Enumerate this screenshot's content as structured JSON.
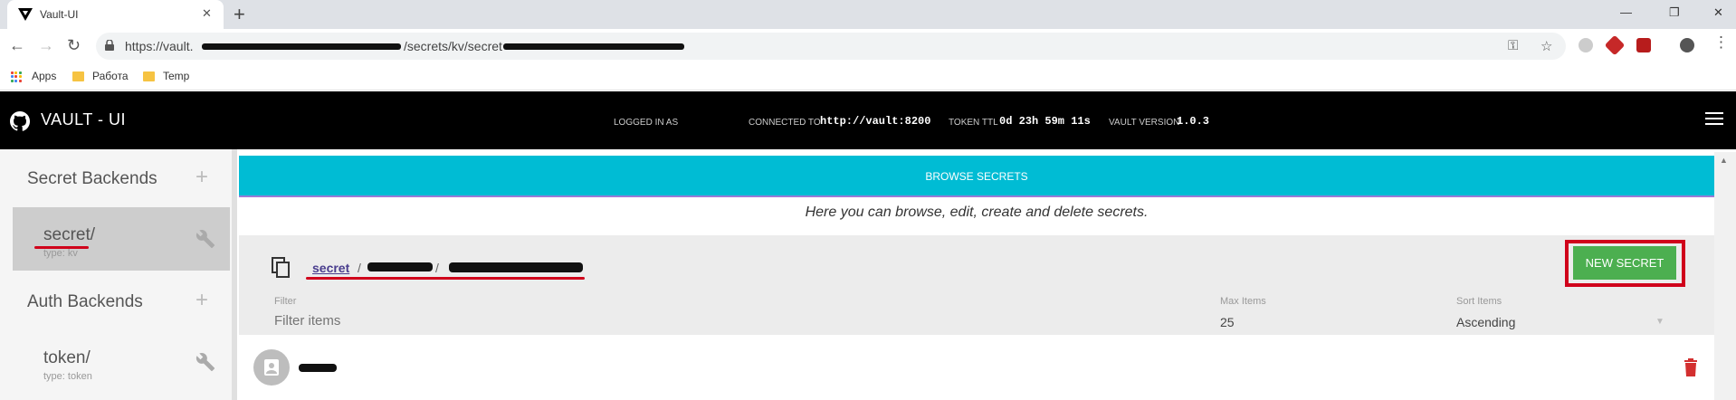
{
  "browser": {
    "tab_title": "Vault-UI",
    "tab_close": "✕",
    "new_tab": "+",
    "url_prefix": "https://vault.",
    "url_mid": "/secrets/kv/secret",
    "back": "←",
    "forward": "→",
    "reload": "↻",
    "win_min": "—",
    "win_max": "❐",
    "win_close": "✕",
    "key_icon": "⚿",
    "star_icon": "☆",
    "menu_icon": "⋮"
  },
  "bookmarks": {
    "apps": "Apps",
    "items": [
      "Работа",
      "Temp"
    ]
  },
  "header": {
    "brand": "VAULT - UI",
    "logged_in_label": "LOGGED IN AS",
    "connected_label": "CONNECTED TO",
    "connected_value": "http://vault:8200",
    "ttl_label": "TOKEN TTL",
    "ttl_value": "0d 23h 59m 11s",
    "version_label": "VAULT VERSION",
    "version_value": "1.0.3"
  },
  "sidebar": {
    "secret_backends": "Secret Backends",
    "auth_backends": "Auth Backends",
    "plus": "+",
    "secret_items": [
      {
        "name": "secret/",
        "type": "type: kv"
      }
    ],
    "auth_items": [
      {
        "name": "token/",
        "type": "type: token"
      }
    ]
  },
  "main": {
    "browse_title": "BROWSE SECRETS",
    "description": "Here you can browse, edit, create and delete secrets.",
    "crumb_root": "secret",
    "crumb_sep": "/",
    "new_secret": "NEW SECRET",
    "filter_label": "Filter",
    "filter_placeholder": "Filter items",
    "max_items_label": "Max Items",
    "max_items_value": "25",
    "sort_label": "Sort Items",
    "sort_value": "Ascending",
    "sort_arrow": "▼"
  },
  "colors": {
    "accent": "#00bcd4",
    "header_bg": "#000000",
    "new_secret": "#4caf50",
    "delete": "#d32f2f",
    "annotation_red": "#d0021b"
  }
}
